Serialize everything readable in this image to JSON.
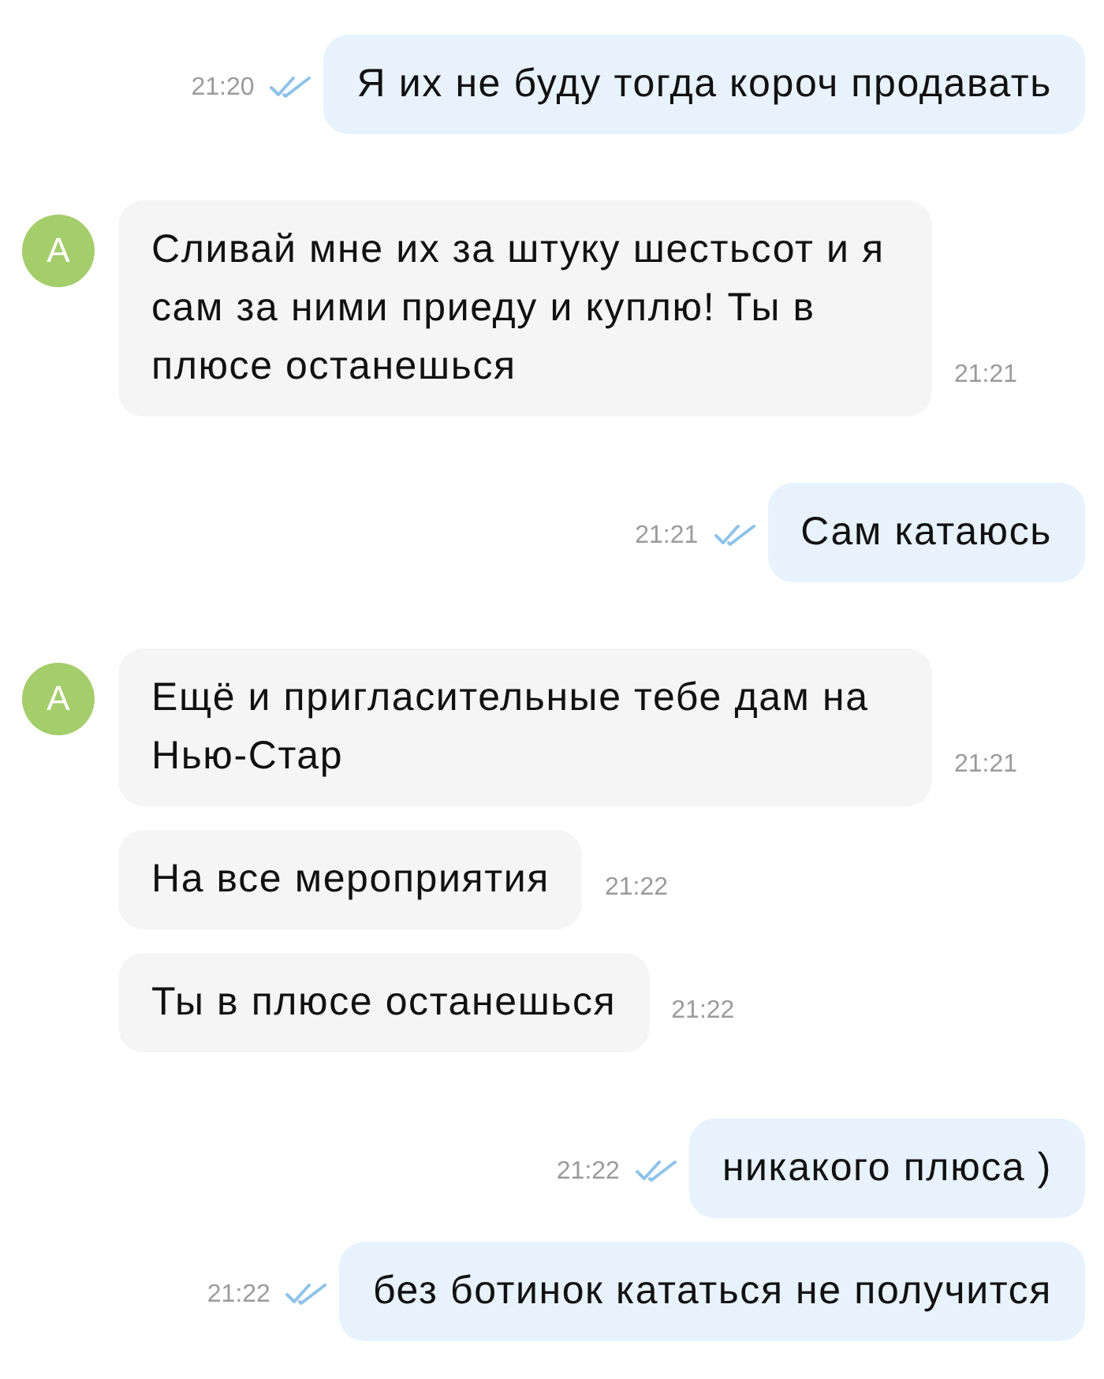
{
  "groups": [
    {
      "kind": "outgoing",
      "messages": [
        {
          "text": "Я их не буду тогда короч продавать",
          "time": "21:20",
          "read": true
        }
      ]
    },
    {
      "kind": "incoming",
      "avatar": "А",
      "messages": [
        {
          "text": "Сливай мне их за штуку шестьсот и я сам за ними приеду и куплю! Ты в плюсе останешься",
          "time": "21:21"
        }
      ]
    },
    {
      "kind": "outgoing",
      "messages": [
        {
          "text": "Сам катаюсь",
          "time": "21:21",
          "read": true
        }
      ]
    },
    {
      "kind": "incoming",
      "avatar": "А",
      "messages": [
        {
          "text": "Ещё и пригласительные тебе дам на Нью-Стар",
          "time": "21:21"
        },
        {
          "text": "На все мероприятия",
          "time": "21:22"
        },
        {
          "text": "Ты в плюсе останешься",
          "time": "21:22"
        }
      ]
    },
    {
      "kind": "outgoing",
      "messages": [
        {
          "text": "никакого плюса )",
          "time": "21:22",
          "read": true
        },
        {
          "text": "без ботинок кататься не получится",
          "time": "21:22",
          "read": true
        }
      ]
    }
  ]
}
